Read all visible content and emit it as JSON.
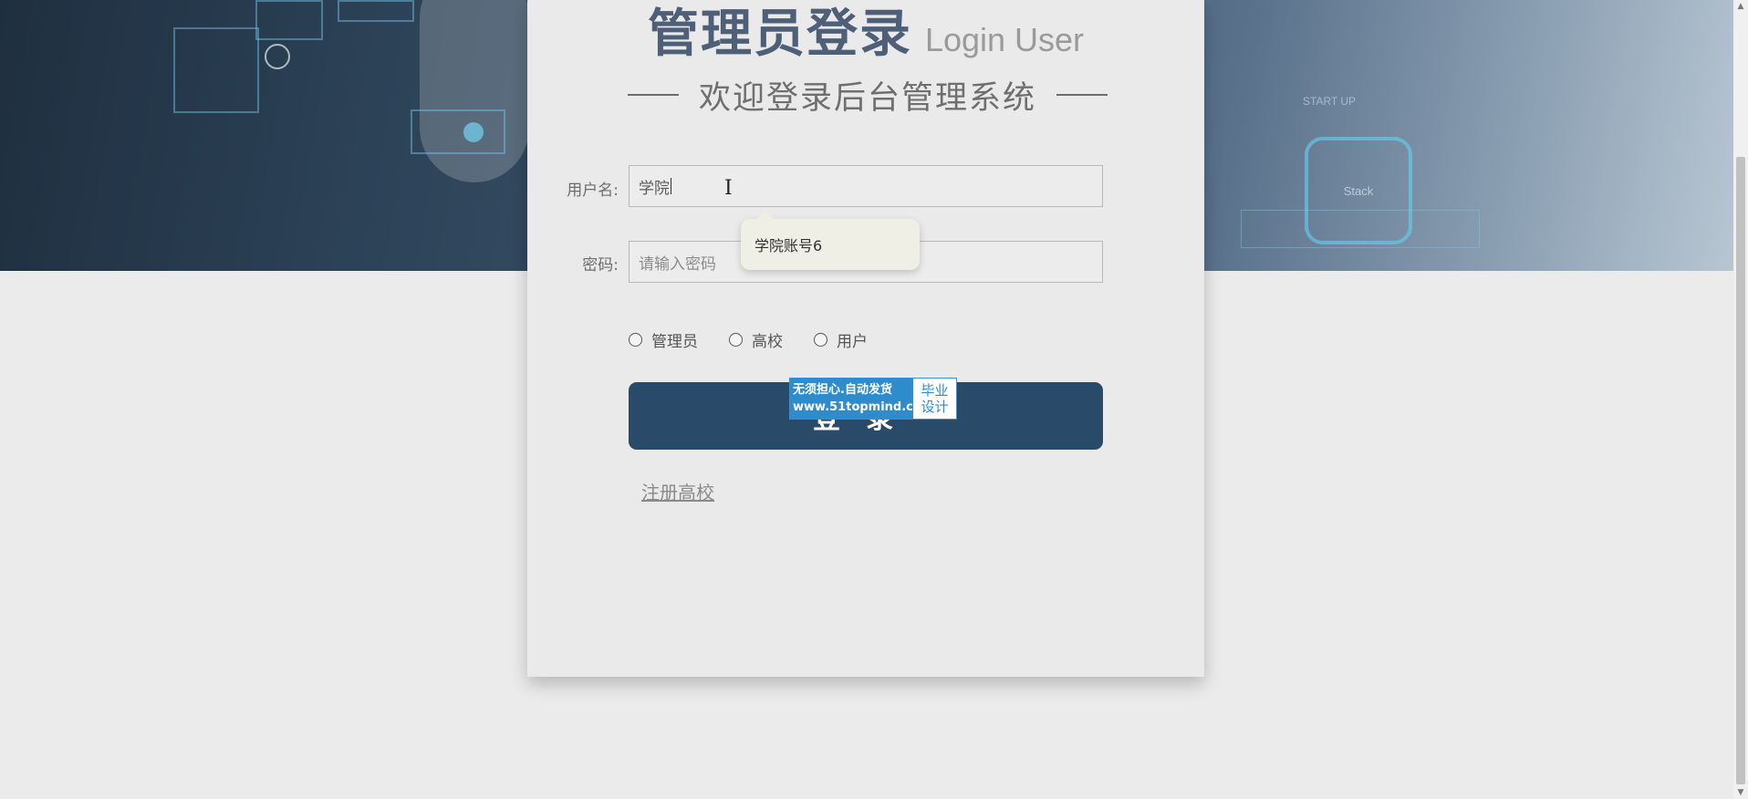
{
  "header": {
    "title_cn": "管理员登录",
    "title_en": "Login User",
    "subtitle": "欢迎登录后台管理系统"
  },
  "form": {
    "username": {
      "label": "用户名:",
      "value": "学院"
    },
    "password": {
      "label": "密码:",
      "placeholder": "请输入密码"
    },
    "autocomplete": {
      "suggestion": "学院账号6"
    },
    "roles": [
      {
        "label": "管理员",
        "checked": false
      },
      {
        "label": "高校",
        "checked": false
      },
      {
        "label": "用户",
        "checked": false
      }
    ],
    "submit_label": "登录",
    "register_link": "注册高校"
  },
  "ad_overlay": {
    "line1": "无须担心.自动发货",
    "line2": "www.51topmind.com",
    "badge_line1": "毕业",
    "badge_line2": "设计"
  },
  "hero": {
    "tile_caption": "START UP",
    "tile_label": "Stack"
  },
  "colors": {
    "primary_button": "#294a68",
    "title": "#4e5f77",
    "page_background": "#ebebeb"
  }
}
